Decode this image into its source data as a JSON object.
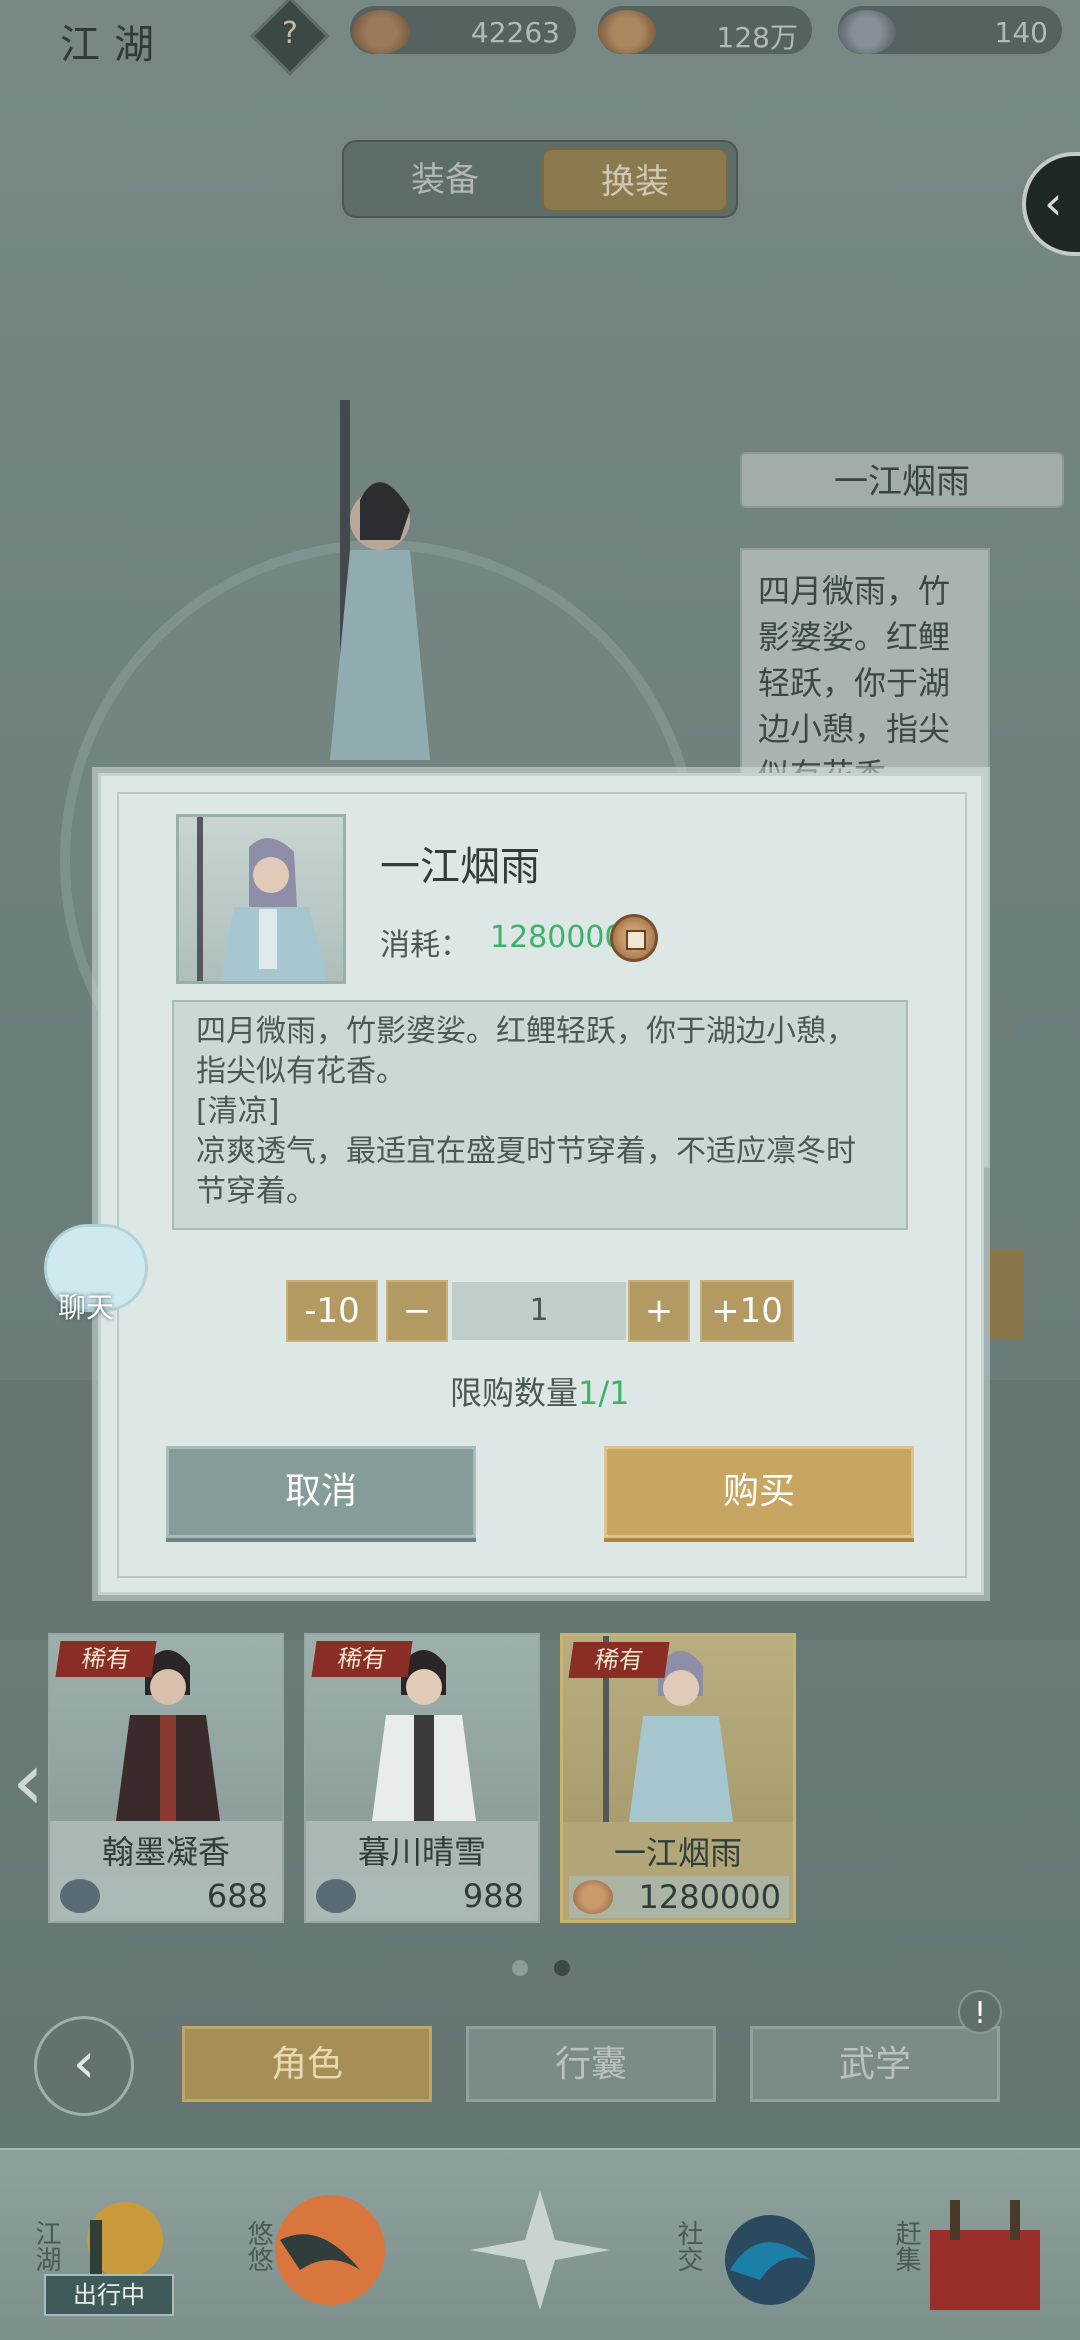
{
  "topbar": {
    "title": "江湖",
    "help_glyph": "?",
    "currencies": [
      {
        "icon": "copper-coin-pouch-icon",
        "value": "42263"
      },
      {
        "icon": "copper-coin-icon",
        "value": "128万"
      },
      {
        "icon": "silver-ingot-icon",
        "value": "140"
      }
    ]
  },
  "tabs": [
    {
      "label": "装备",
      "active": false
    },
    {
      "label": "换装",
      "active": true
    }
  ],
  "side_panel": {
    "outfit_name": "一江烟雨",
    "description_preview": "四月微雨，竹影婆娑。红鲤轻跃，你于湖边小憩，指尖似有花香。"
  },
  "modal": {
    "item_name": "一江烟雨",
    "cost_label": "消耗：",
    "cost_value": "1280000",
    "description": "四月微雨，竹影婆娑。红鲤轻跃，你于湖边小憩，指尖似有花香。\n[清凉]\n凉爽透气，最适宜在盛夏时节穿着，不适应凛冬时节穿着。",
    "qty_minus10": "-10",
    "qty_minus": "−",
    "qty_value": "1",
    "qty_plus": "+",
    "qty_plus10": "+10",
    "limit_label": "限购数量",
    "limit_value": "1/1",
    "cancel_label": "取消",
    "buy_label": "购买"
  },
  "chat": {
    "label": "聊天"
  },
  "outfits": [
    {
      "tag": "稀有",
      "name": "翰墨凝香",
      "price": "688",
      "currency_icon": "silver-ingot-icon",
      "selected": false
    },
    {
      "tag": "稀有",
      "name": "暮川晴雪",
      "price": "988",
      "currency_icon": "silver-ingot-icon",
      "selected": false
    },
    {
      "tag": "稀有",
      "name": "一江烟雨",
      "price": "1280000",
      "currency_icon": "copper-coin-icon",
      "selected": true
    }
  ],
  "pagination": {
    "pages": 2,
    "current": 2
  },
  "nav": {
    "back_glyph": "‹",
    "tabs": [
      {
        "label": "角色",
        "active": true
      },
      {
        "label": "行囊",
        "active": false
      },
      {
        "label": "武学",
        "active": false
      }
    ],
    "warning_glyph": "!"
  },
  "bottom_bar": {
    "items": [
      {
        "label": "江湖",
        "badge": "出行中"
      },
      {
        "label": "悠悠"
      },
      {
        "label": ""
      },
      {
        "label": "社交"
      },
      {
        "label": "赶集"
      }
    ]
  },
  "colors": {
    "accent_gold": "#b39a63",
    "cost_green": "#3db36a",
    "cancel_teal": "#869c9a",
    "rare_tag_red": "#8a2d25"
  }
}
